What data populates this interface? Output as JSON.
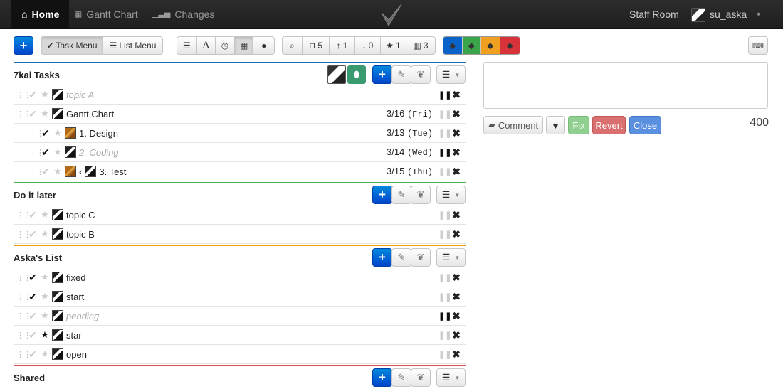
{
  "nav": {
    "home": "Home",
    "gantt": "Gantt Chart",
    "changes": "Changes",
    "staff_room": "Staff Room",
    "user": "su_aska"
  },
  "toolbar": {
    "task_menu": "Task Menu",
    "list_menu": "List Menu",
    "inbox_count": "5",
    "up_count": "1",
    "down_count": "0",
    "star_count": "1",
    "trash_count": "3",
    "tag_colors": [
      "#0a63c9",
      "#3aa54a",
      "#f0a020",
      "#d8333a"
    ]
  },
  "comment": {
    "comment_label": "Comment",
    "fix_label": "Fix",
    "revert_label": "Revert",
    "close_label": "Close",
    "remaining": "400"
  },
  "lists": [
    {
      "title": "7kai Tasks",
      "color": "#1a6fb5",
      "tasks": [
        {
          "title": "topic A",
          "dim": true,
          "done": false,
          "star": false,
          "pause_on": true,
          "date": "",
          "dow": ""
        },
        {
          "title": "Gantt Chart",
          "dim": false,
          "done": false,
          "star": false,
          "pause_on": false,
          "date": "3/16",
          "dow": "(Fri)"
        },
        {
          "title": "1. Design",
          "dim": false,
          "done": true,
          "star": false,
          "pause_on": false,
          "date": "3/13",
          "dow": "(Tue)"
        },
        {
          "title": "2. Coding",
          "dim": true,
          "done": true,
          "star": false,
          "pause_on": true,
          "date": "3/14",
          "dow": "(Wed)"
        },
        {
          "title": "3. Test",
          "dim": false,
          "done": false,
          "star": false,
          "pause_on": false,
          "date": "3/15",
          "dow": "(Thu)"
        }
      ]
    },
    {
      "title": "Do it later",
      "color": "#4caf50",
      "tasks": [
        {
          "title": "topic C",
          "dim": false,
          "done": false,
          "star": false,
          "pause_on": false,
          "date": "",
          "dow": ""
        },
        {
          "title": "topic B",
          "dim": false,
          "done": false,
          "star": false,
          "pause_on": false,
          "date": "",
          "dow": ""
        }
      ]
    },
    {
      "title": "Aska's List",
      "color": "#f39c12",
      "tasks": [
        {
          "title": "fixed",
          "dim": false,
          "done": true,
          "star": false,
          "pause_on": false,
          "date": "",
          "dow": ""
        },
        {
          "title": "start",
          "dim": false,
          "done": true,
          "star": false,
          "pause_on": false,
          "date": "",
          "dow": ""
        },
        {
          "title": "pending",
          "dim": true,
          "done": false,
          "star": false,
          "pause_on": true,
          "date": "",
          "dow": ""
        },
        {
          "title": "star",
          "dim": false,
          "done": false,
          "star": true,
          "pause_on": false,
          "date": "",
          "dow": ""
        },
        {
          "title": "open",
          "dim": false,
          "done": false,
          "star": false,
          "pause_on": false,
          "date": "",
          "dow": ""
        }
      ]
    },
    {
      "title": "Shared",
      "color": "#e05050",
      "tasks": []
    }
  ]
}
